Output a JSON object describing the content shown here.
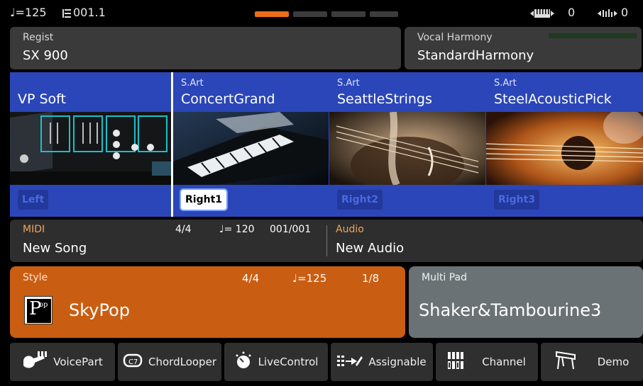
{
  "status": {
    "tempo": "♩=125",
    "measure": "001.1",
    "pages": [
      true,
      false,
      false,
      false
    ],
    "keyboard_indicator": "0",
    "audio_indicator": "0"
  },
  "regist": {
    "label": "Regist",
    "value": "SX 900"
  },
  "vocal_harmony": {
    "label": "Vocal Harmony",
    "value": "StandardHarmony"
  },
  "voices": [
    {
      "sub": "",
      "name": "VP Soft",
      "part": "Left",
      "active": false
    },
    {
      "sub": "S.Art",
      "name": "ConcertGrand",
      "part": "Right1",
      "active": true
    },
    {
      "sub": "S.Art",
      "name": "SeattleStrings",
      "part": "Right2",
      "active": false
    },
    {
      "sub": "S.Art",
      "name": "SteelAcousticPick",
      "part": "Right3",
      "active": false
    }
  ],
  "midi": {
    "label": "MIDI",
    "value": "New Song",
    "time_sig": "4/4",
    "tempo": "♩= 120",
    "position": "001/001"
  },
  "audio": {
    "label": "Audio",
    "value": "New Audio"
  },
  "style": {
    "label": "Style",
    "name": "SkyPop",
    "time_sig": "4/4",
    "tempo": "♩=125",
    "position": "1/8",
    "icon_text": "P",
    "icon_sup": "op",
    "color": "#c95d12"
  },
  "multipad": {
    "label": "Multi Pad",
    "value": "Shaker&Tambourine3"
  },
  "bottom": [
    {
      "label": "VoicePart",
      "icon": "voice-part-icon"
    },
    {
      "label": "ChordLooper",
      "icon": "chord-looper-icon"
    },
    {
      "label": "LiveControl",
      "icon": "live-control-icon"
    },
    {
      "label": "Assignable",
      "icon": "assignable-icon"
    },
    {
      "label": "Channel",
      "icon": "channel-icon"
    },
    {
      "label": "Demo",
      "icon": "demo-icon"
    }
  ]
}
